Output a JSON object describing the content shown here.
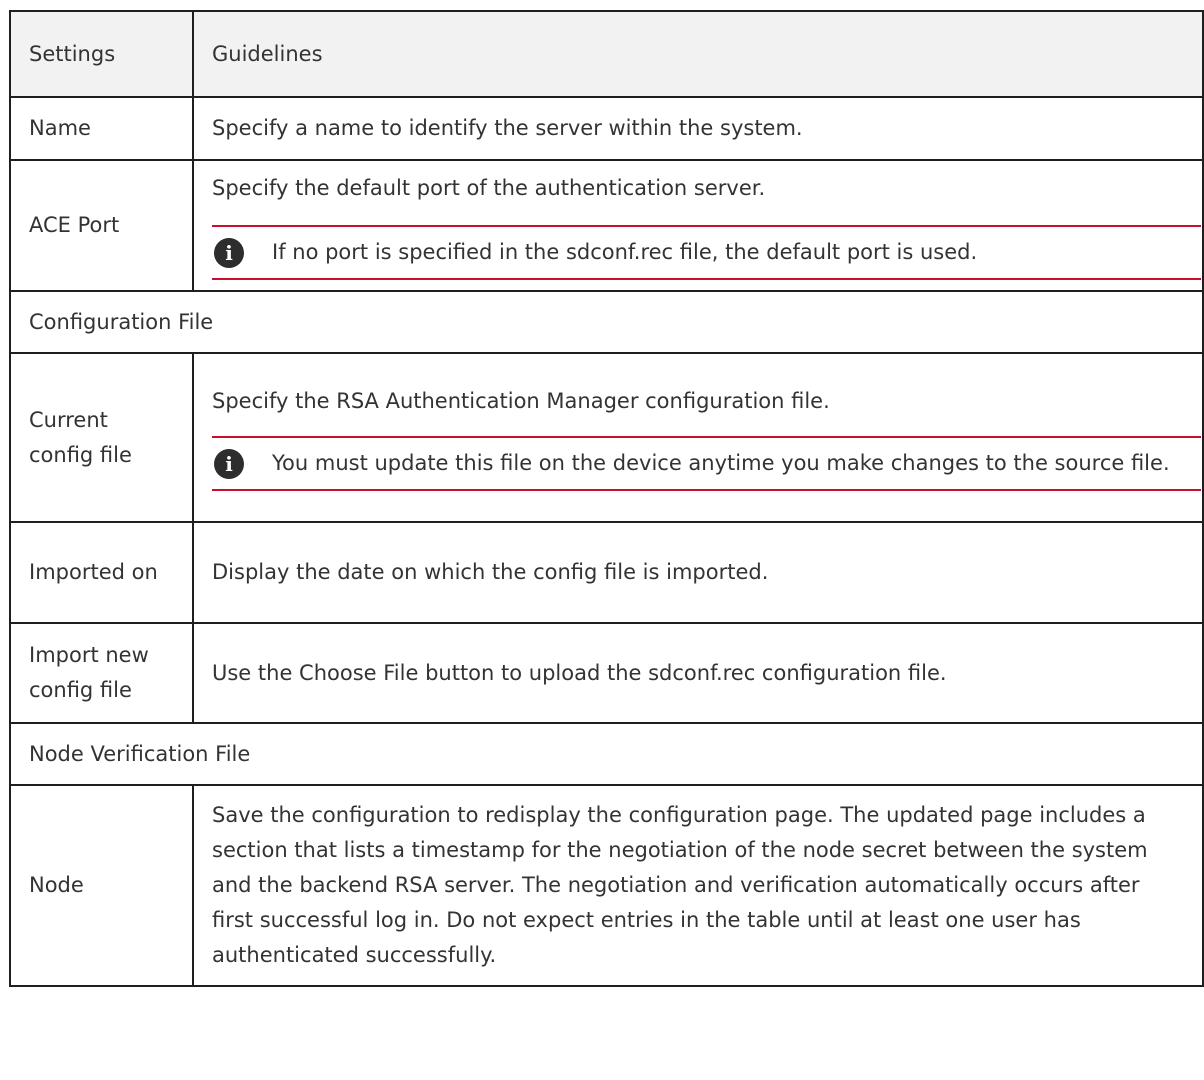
{
  "header": {
    "col1": "Settings",
    "col2": "Guidelines"
  },
  "rows": {
    "name": {
      "setting": "Name",
      "guideline": "Specify a name to identify the server within the system."
    },
    "ace_port": {
      "setting": "ACE Port",
      "guideline": "Specify the default port of the authentication server.",
      "note": "If no port is specified in the sdconf.rec file, the default port is used."
    },
    "section_config": "Configuration File",
    "current_config": {
      "setting": "Current config file",
      "guideline": "Specify the RSA Authentication Manager configuration file.",
      "note": "You must update this file on the device anytime you make changes to the source file."
    },
    "imported_on": {
      "setting": "Imported on",
      "guideline": "Display the date on which the config file is imported."
    },
    "import_new": {
      "setting": "Import new config file",
      "guideline": "Use the Choose File button to upload the sdconf.rec configuration file."
    },
    "section_node": "Node Verification File",
    "node": {
      "setting": "Node",
      "guideline": "Save the configuration to redisplay the configuration page. The updated page includes a section that lists a timestamp for the negotiation of the node secret between the system and the backend RSA server. The negotiation and verification automatically occurs after first successful log in. Do not expect entries in the table until at least one user has authenticated successfully."
    }
  },
  "icons": {
    "note": "info-icon",
    "note_glyph": "i"
  },
  "colors": {
    "note_rule": "#c8102e",
    "border": "#1f1f1f",
    "header_bg": "#f2f2f2",
    "text": "#333333"
  }
}
